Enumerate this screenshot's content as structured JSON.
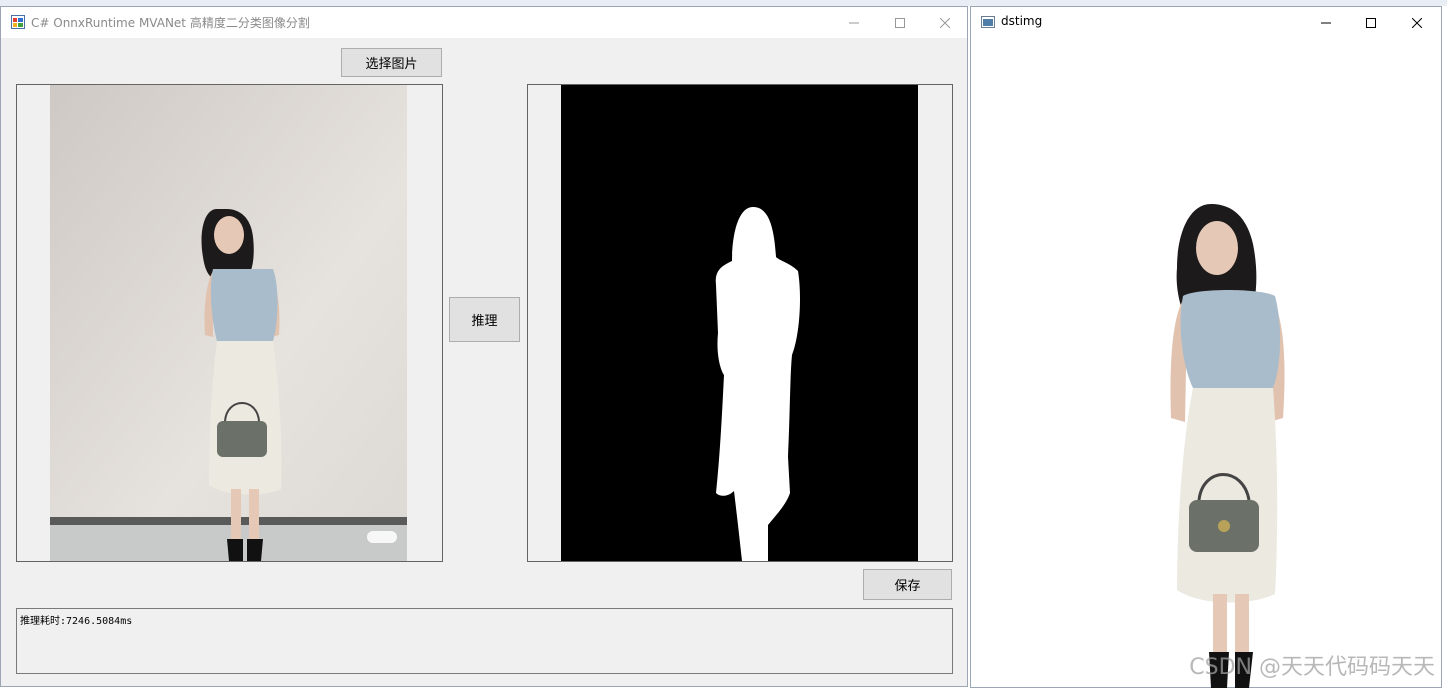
{
  "main_window": {
    "title": "C# OnnxRuntime MVANet 高精度二分类图像分割",
    "select_button": "选择图片",
    "infer_button": "推理",
    "save_button": "保存",
    "log_text": "推理耗时:7246.5084ms"
  },
  "dst_window": {
    "title": "dstimg"
  },
  "watermark": "CSDN @天天代码码天天",
  "icons": {
    "app": "app-window-icon",
    "minimize": "minimize-icon",
    "maximize": "maximize-icon",
    "close": "close-icon"
  },
  "colors": {
    "window_bg": "#f0f0f0",
    "button_bg": "#e1e1e1",
    "mask_bg": "#000000",
    "top_color": "#a9bccb",
    "skirt_color": "#ece9e0",
    "hair_color": "#1c1a1a"
  }
}
